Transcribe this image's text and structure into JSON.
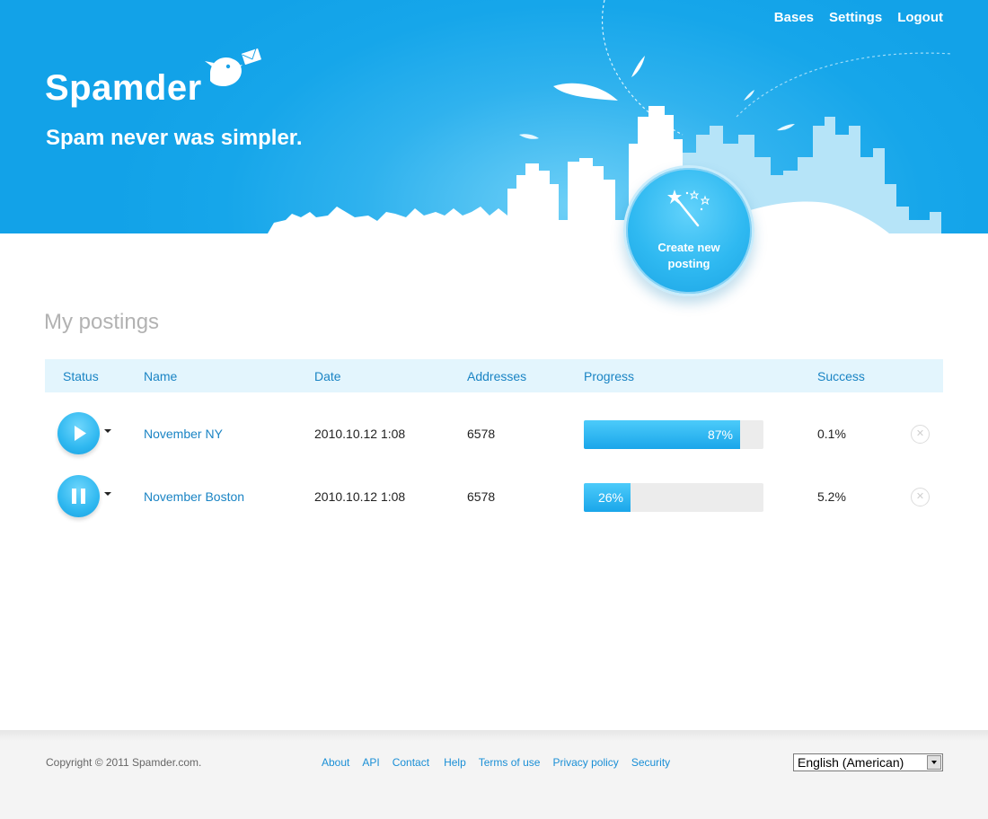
{
  "nav": {
    "items": [
      "Bases",
      "Settings",
      "Logout"
    ]
  },
  "brand": {
    "name": "Spamder",
    "tagline": "Spam never was simpler."
  },
  "create_button": {
    "label": "Create new posting"
  },
  "main": {
    "title": "My postings",
    "columns": [
      "Status",
      "Name",
      "Date",
      "Addresses",
      "Progress",
      "Success"
    ],
    "rows": [
      {
        "status": "play",
        "name": "November NY",
        "date": "2010.10.12 1:08",
        "addresses": "6578",
        "progress": 87,
        "progress_label": "87%",
        "success": "0.1%"
      },
      {
        "status": "pause",
        "name": "November Boston",
        "date": "2010.10.12 1:08",
        "addresses": "6578",
        "progress": 26,
        "progress_label": "26%",
        "success": "5.2%"
      }
    ]
  },
  "footer": {
    "copyright": "Copyright © 2011 Spamder.com.",
    "links": [
      "About",
      "API",
      "Contact",
      "Help",
      "Terms of use",
      "Privacy policy",
      "Security"
    ],
    "language": "English (American)"
  },
  "colors": {
    "header_blue": "#12a2e8",
    "link_blue": "#1a84c4",
    "progress_fill": "#1aa6ea"
  },
  "icons": [
    "bird-logo-icon",
    "envelope-icon",
    "magic-wand-icon",
    "play-icon",
    "pause-icon",
    "close-icon",
    "chevron-down-icon"
  ]
}
